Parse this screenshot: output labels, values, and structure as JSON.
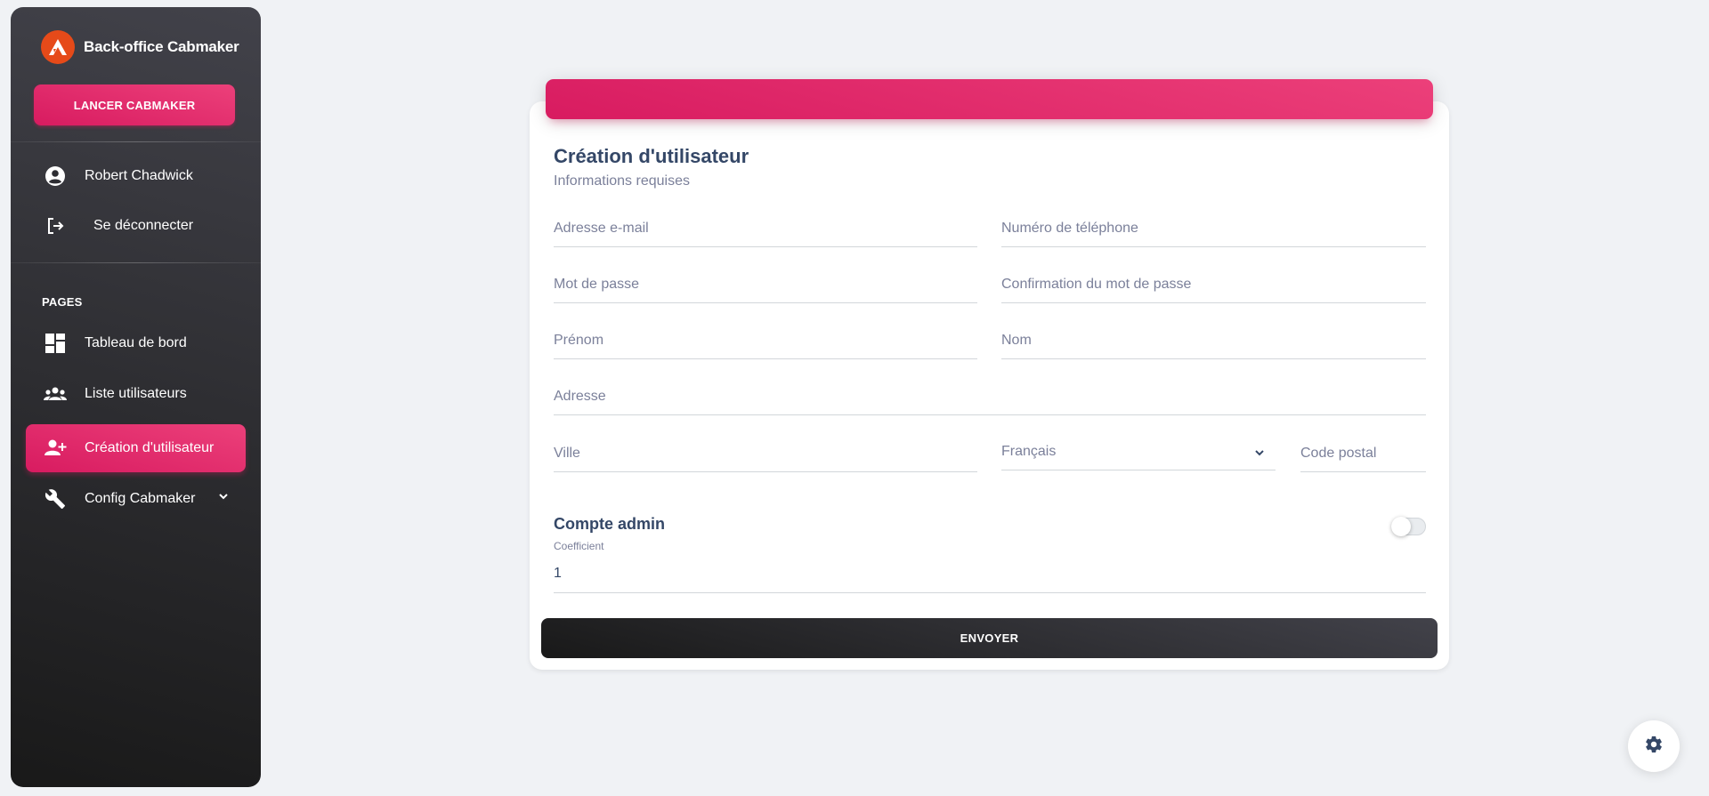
{
  "sidebar": {
    "brand": "Back-office Cabmaker",
    "launch_button": "LANCER CABMAKER",
    "user_name": "Robert Chadwick",
    "logout": "Se déconnecter",
    "section_title": "PAGES",
    "items": [
      {
        "label": "Tableau de bord",
        "icon": "dashboard-icon"
      },
      {
        "label": "Liste utilisateurs",
        "icon": "users-icon"
      },
      {
        "label": "Création d'utilisateur",
        "icon": "add-user-icon",
        "active": true
      },
      {
        "label": "Config Cabmaker",
        "icon": "wrench-icon"
      }
    ]
  },
  "form": {
    "title": "Création d'utilisateur",
    "subtitle": "Informations requises",
    "fields": {
      "email": "Adresse e-mail",
      "phone": "Numéro de téléphone",
      "password": "Mot de passe",
      "password_confirm": "Confirmation du mot de passe",
      "first_name": "Prénom",
      "last_name": "Nom",
      "address": "Adresse",
      "city": "Ville",
      "language": "Français",
      "postal_code": "Code postal"
    },
    "admin_label": "Compte admin",
    "admin_enabled": false,
    "coefficient_label": "Coefficient",
    "coefficient_value": "1",
    "submit": "ENVOYER"
  },
  "colors": {
    "accent": "#d81b60",
    "accent_light": "#ec407a",
    "dark": "#191919",
    "text": "#344767",
    "muted": "#7b809a"
  }
}
